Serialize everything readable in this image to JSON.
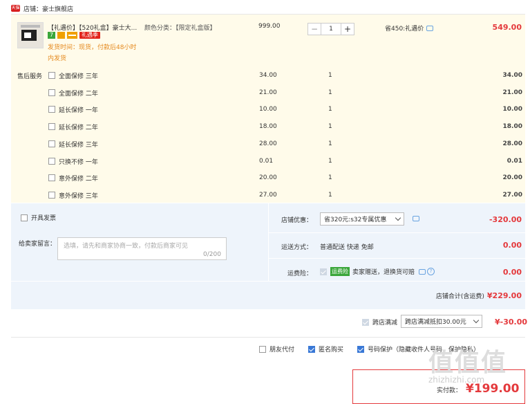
{
  "shop": {
    "logo_text": "天猫",
    "label": "店铺：",
    "name": "豪士旗舰店"
  },
  "product": {
    "title": "【礼遇价】【520礼盒】豪士大...",
    "sku_label": "颜色分类：【限定礼盒版】",
    "badges": {
      "seven_days": "7",
      "gift": "礼遇季"
    },
    "ship_time": "发货时间：现货，付款后48小时",
    "ship_time2": "内发货",
    "unit_price": "999.00",
    "qty": "1",
    "qty_minus": "−",
    "qty_plus": "+",
    "save": "省450:礼遇价",
    "total": "549.00"
  },
  "services": {
    "label": "售后服务",
    "items": [
      {
        "name": "全面保修 三年",
        "price": "34.00",
        "qty": "1",
        "sum": "34.00"
      },
      {
        "name": "全面保修 二年",
        "price": "21.00",
        "qty": "1",
        "sum": "21.00"
      },
      {
        "name": "延长保修 一年",
        "price": "10.00",
        "qty": "1",
        "sum": "10.00"
      },
      {
        "name": "延长保修 二年",
        "price": "18.00",
        "qty": "1",
        "sum": "18.00"
      },
      {
        "name": "延长保修 三年",
        "price": "28.00",
        "qty": "1",
        "sum": "28.00"
      },
      {
        "name": "只换不修 一年",
        "price": "0.01",
        "qty": "1",
        "sum": "0.01"
      },
      {
        "name": "意外保修 二年",
        "price": "20.00",
        "qty": "1",
        "sum": "20.00"
      },
      {
        "name": "意外保修 三年",
        "price": "27.00",
        "qty": "1",
        "sum": "27.00"
      }
    ]
  },
  "invoice": {
    "label": "开具发票"
  },
  "message": {
    "label": "给卖家留言：",
    "placeholder": "选填，请先和商家协商一致，付款后商家可见",
    "count": "0/200"
  },
  "shop_discount": {
    "label": "店铺优惠：",
    "selected": "省320元:s32专属优惠",
    "amount": "-320.00"
  },
  "delivery": {
    "label": "运送方式：",
    "value": "普通配送 快递 免邮",
    "amount": "0.00"
  },
  "insurance": {
    "label": "运费险：",
    "badge": "运费险",
    "value": "卖家赠送，退换货可赔",
    "amount": "0.00"
  },
  "shop_total": {
    "label": "店铺合计(含运费)",
    "amount": "¥229.00"
  },
  "cross_store": {
    "label": "跨店满减",
    "selected": "跨店满减抵扣30.00元",
    "amount": "¥-30.00"
  },
  "options": {
    "friend_pay": "朋友代付",
    "anonymous": "匿名购买",
    "number_protect": "号码保护（隐藏收件人号码，保护隐私）"
  },
  "pay": {
    "label": "实付款：",
    "amount": "¥199.00"
  },
  "watermark": {
    "text": "值值值",
    "url": "zhizhizhi.com"
  },
  "colors": {
    "accent_red": "#e4393c",
    "orange": "#e58a1f",
    "panel_blue": "#eef4fb",
    "check_blue": "#3978d6"
  }
}
